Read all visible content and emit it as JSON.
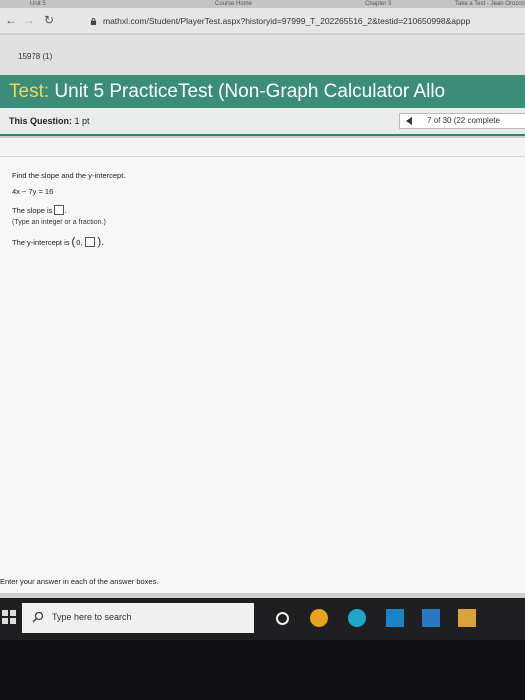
{
  "browser": {
    "tabs": [
      "Unit 5",
      "Course Home",
      "Chapter 3",
      "Take a Test - Jean Orozco"
    ],
    "url": "mathxl.com/Student/PlayerTest.aspx?historyid=97999_T_202265516_2&testid=210650998&appp",
    "tab_name": "15978 (1)"
  },
  "test": {
    "title_prefix": "Test:",
    "title": "Unit 5 PracticeTest (Non-Graph Calculator Allo",
    "question_label": "This Question:",
    "question_points": "1 pt",
    "question_count": "7 of 30 (22 complete"
  },
  "question": {
    "prompt": "Find the slope and the y-intercept.",
    "equation": "4x − 7y = 16",
    "slope_label": "The slope is",
    "slope_value": "",
    "hint": "(Type an integer or a fraction.)",
    "yint_label": "The y-intercept is",
    "yint_open": "(",
    "yint_x": "0,",
    "yint_value": "",
    "yint_close": ")."
  },
  "footer": {
    "instruction": "Enter your answer in each of the answer boxes."
  },
  "taskbar": {
    "search_placeholder": "Type here to search"
  },
  "colors": {
    "header_bg": "#3c8c7a",
    "title_prefix": "#f0d85a",
    "question_bar_accent": "#1f8b75"
  }
}
